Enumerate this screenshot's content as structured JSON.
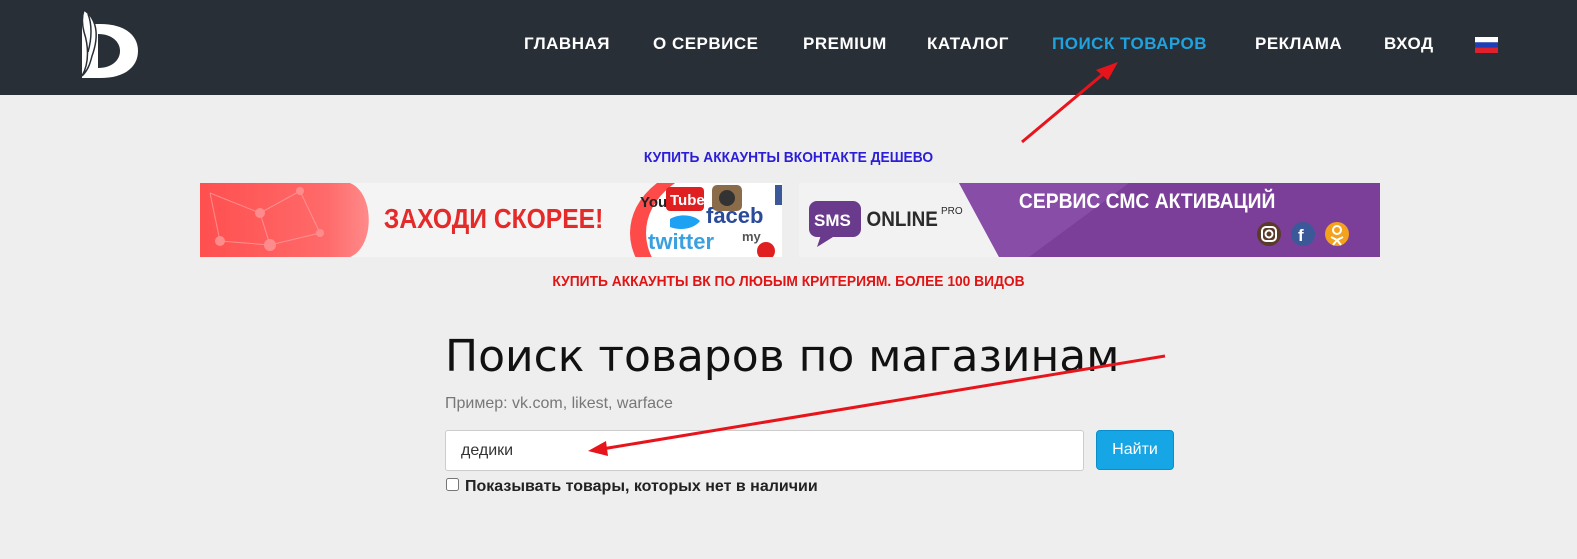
{
  "navbar": {
    "items": [
      {
        "label": "ГЛАВНАЯ",
        "active": false
      },
      {
        "label": "О СЕРВИСЕ",
        "active": false
      },
      {
        "label": "PREMIUM",
        "active": false
      },
      {
        "label": "КАТАЛОГ",
        "active": false
      },
      {
        "label": "ПОИСК ТОВАРОВ",
        "active": true
      },
      {
        "label": "РЕКЛАМА",
        "active": false
      },
      {
        "label": "ВХОД",
        "active": false
      }
    ],
    "language_flag": "russia-flag-icon",
    "colors": {
      "background": "#292f36",
      "text": "#ffffff",
      "active": "#1fa3e0"
    }
  },
  "promo": {
    "top_text": "КУПИТЬ АККАУНТЫ ВКОНТАКТЕ ДЕШЕВО",
    "bottom_text": "КУПИТЬ АККАУНТЫ ВК ПО ЛЮБЫМ КРИТЕРИЯМ. БОЛЕЕ 100 ВИДОВ"
  },
  "banners": {
    "left": {
      "headline": "ЗАХОДИ СКОРЕЕ!",
      "social_words": [
        "You",
        "Tube",
        "faceb",
        "twitter",
        "my"
      ]
    },
    "right": {
      "brand_sms": "SMS",
      "brand_online": "ONLINE",
      "brand_pro": "PRO",
      "headline": "СЕРВИС СМС АКТИВАЦИЙ",
      "icons": [
        "instagram-icon",
        "facebook-icon",
        "odnoklassniki-icon"
      ]
    }
  },
  "search": {
    "title": "Поиск товаров по магазинам",
    "example": "Пример: vk.com, likest, warface",
    "input_value": "дедики",
    "button_label": "Найти",
    "checkbox_label": "Показывать товары, которых нет в наличии",
    "checkbox_checked": false
  }
}
